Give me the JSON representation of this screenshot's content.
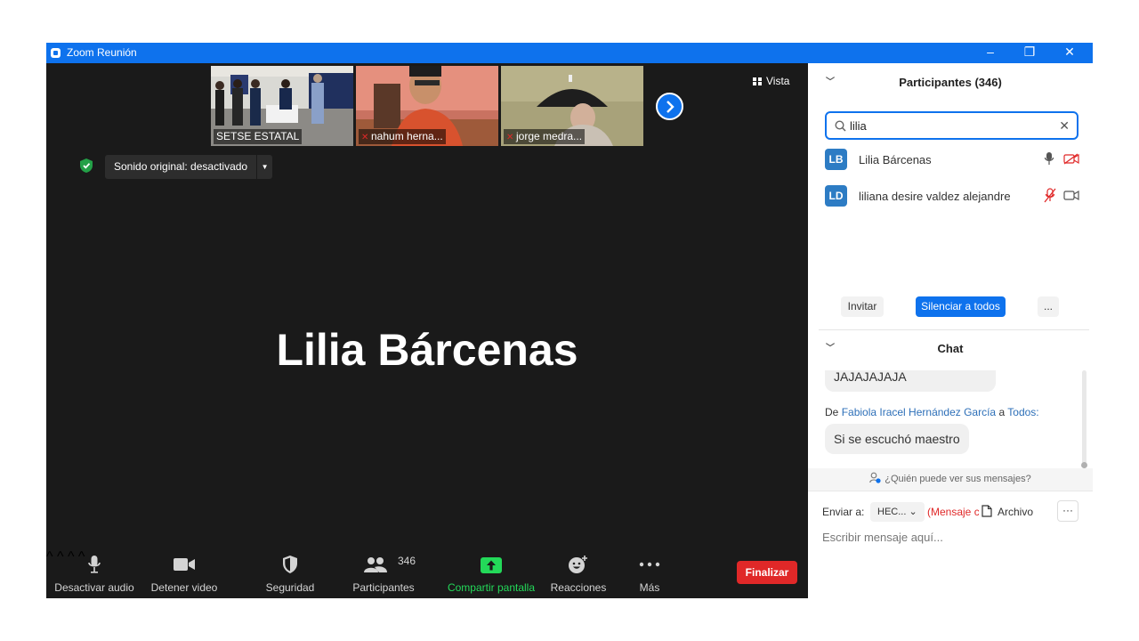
{
  "window": {
    "title": "Zoom Reunión",
    "minimize": "–",
    "restore": "❐",
    "close": "✕"
  },
  "colors": {
    "accent": "#0e72ed",
    "end_red": "#e02828",
    "share_green": "#23d959",
    "avatar_blue": "#2d7cc4"
  },
  "thumbnails": [
    {
      "name": "SETSE ESTATAL",
      "muted": false
    },
    {
      "name": "nahum herna...",
      "muted": true
    },
    {
      "name": "jorge medra...",
      "muted": true
    }
  ],
  "view_label": "Vista",
  "sound_original": "Sonido original: desactivado",
  "active_speaker": "Lilia Bárcenas",
  "toolbar": {
    "audio": "Desactivar audio",
    "video": "Detener video",
    "security": "Seguridad",
    "participants": "Participantes",
    "participants_count": "346",
    "share": "Compartir pantalla",
    "reactions": "Reacciones",
    "more": "Más",
    "end": "Finalizar"
  },
  "participants_panel": {
    "title": "Participantes (346)",
    "search_value": "lilia",
    "rows": [
      {
        "initials": "LB",
        "name": "Lilia Bárcenas",
        "mic": "on",
        "video": "off"
      },
      {
        "initials": "LD",
        "name": "liliana desire valdez alejandre",
        "mic": "off",
        "video": "on"
      }
    ],
    "invite": "Invitar",
    "mute_all": "Silenciar a todos",
    "more": "..."
  },
  "chat": {
    "title": "Chat",
    "messages": [
      {
        "text": "JAJAJAJAJA"
      },
      {
        "prefix": "De",
        "from": "Fabiola Iracel Hernández García",
        "joiner": "a",
        "to": "Todos:",
        "text": "Si se escuchó maestro"
      }
    ],
    "who_sees": "¿Quién puede ver sus mensajes?",
    "send_to_label": "Enviar a:",
    "send_to_value": "HEC...",
    "private_note": "(Mensaje c",
    "file_label": "Archivo",
    "more": "···",
    "input_placeholder": "Escribir mensaje aquí..."
  }
}
